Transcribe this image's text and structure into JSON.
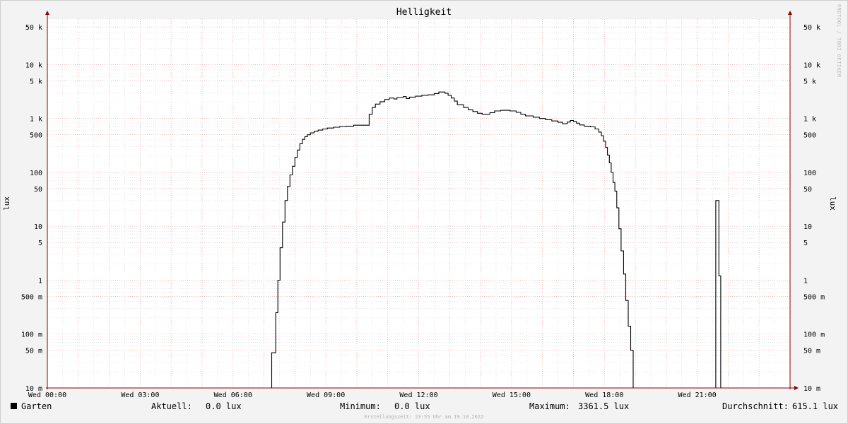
{
  "title": "Helligkeit",
  "watermark": "RRDTOOL / TOBI OETIKER",
  "footer": "Erstellungszeit: 23:55 Uhr am 19.10.2022",
  "legend": {
    "series_name": "Garten",
    "current_label": "Aktuell:",
    "current_value": "0.0 lux",
    "min_label": "Minimum:",
    "min_value": "0.0 lux",
    "max_label": "Maximum:",
    "max_value": "3361.5 lux",
    "avg_label": "Durchschnitt:",
    "avg_value": "615.1 lux"
  },
  "colors": {
    "background": "#f3f3f3",
    "plot_background": "#ffffff",
    "major_grid": "#e8a0a0",
    "minor_grid": "#d8d8d8",
    "axis": "#8b0000",
    "line": "#000000"
  },
  "chart_data": {
    "type": "line",
    "title": "Helligkeit",
    "ylabel": "lux",
    "y_scale": "log",
    "ylim": [
      0.01,
      70000
    ],
    "xlim": [
      0,
      24
    ],
    "grid": true,
    "y_ticks": [
      {
        "value": 0.01,
        "label": "10 m"
      },
      {
        "value": 0.05,
        "label": "50 m"
      },
      {
        "value": 0.1,
        "label": "100 m"
      },
      {
        "value": 0.5,
        "label": "500 m"
      },
      {
        "value": 1,
        "label": "1"
      },
      {
        "value": 5,
        "label": "5"
      },
      {
        "value": 10,
        "label": "10"
      },
      {
        "value": 50,
        "label": "50"
      },
      {
        "value": 100,
        "label": "100"
      },
      {
        "value": 500,
        "label": "500"
      },
      {
        "value": 1000,
        "label": "1 k"
      },
      {
        "value": 5000,
        "label": "5 k"
      },
      {
        "value": 10000,
        "label": "10 k"
      },
      {
        "value": 50000,
        "label": "50 k"
      }
    ],
    "x_ticks": [
      {
        "value": 0,
        "label": "Wed 00:00"
      },
      {
        "value": 3,
        "label": "Wed 03:00"
      },
      {
        "value": 6,
        "label": "Wed 06:00"
      },
      {
        "value": 9,
        "label": "Wed 09:00"
      },
      {
        "value": 12,
        "label": "Wed 12:00"
      },
      {
        "value": 15,
        "label": "Wed 15:00"
      },
      {
        "value": 18,
        "label": "Wed 18:00"
      },
      {
        "value": 21,
        "label": "Wed 21:00"
      }
    ],
    "series": [
      {
        "name": "Garten",
        "points": [
          [
            0,
            0.01
          ],
          [
            7.25,
            0.01
          ],
          [
            7.25,
            0.045
          ],
          [
            7.38,
            0.045
          ],
          [
            7.38,
            0.25
          ],
          [
            7.45,
            0.25
          ],
          [
            7.45,
            1.0
          ],
          [
            7.52,
            1.0
          ],
          [
            7.52,
            4.0
          ],
          [
            7.6,
            4.0
          ],
          [
            7.6,
            12
          ],
          [
            7.68,
            12
          ],
          [
            7.68,
            30
          ],
          [
            7.76,
            30
          ],
          [
            7.76,
            55
          ],
          [
            7.84,
            55
          ],
          [
            7.84,
            90
          ],
          [
            7.92,
            90
          ],
          [
            7.92,
            130
          ],
          [
            8.0,
            130
          ],
          [
            8.0,
            190
          ],
          [
            8.08,
            190
          ],
          [
            8.08,
            260
          ],
          [
            8.16,
            260
          ],
          [
            8.16,
            340
          ],
          [
            8.24,
            340
          ],
          [
            8.24,
            410
          ],
          [
            8.32,
            410
          ],
          [
            8.32,
            460
          ],
          [
            8.4,
            460
          ],
          [
            8.4,
            500
          ],
          [
            8.5,
            500
          ],
          [
            8.5,
            540
          ],
          [
            8.62,
            540
          ],
          [
            8.62,
            580
          ],
          [
            8.75,
            580
          ],
          [
            8.75,
            610
          ],
          [
            8.9,
            610
          ],
          [
            8.9,
            640
          ],
          [
            9.05,
            640
          ],
          [
            9.05,
            665
          ],
          [
            9.25,
            665
          ],
          [
            9.25,
            690
          ],
          [
            9.45,
            690
          ],
          [
            9.45,
            710
          ],
          [
            9.65,
            710
          ],
          [
            9.65,
            720
          ],
          [
            9.9,
            720
          ],
          [
            9.9,
            750
          ],
          [
            10.4,
            750
          ],
          [
            10.4,
            1200
          ],
          [
            10.5,
            1200
          ],
          [
            10.5,
            1600
          ],
          [
            10.6,
            1600
          ],
          [
            10.6,
            1850
          ],
          [
            10.75,
            1850
          ],
          [
            10.75,
            2050
          ],
          [
            10.9,
            2050
          ],
          [
            10.9,
            2250
          ],
          [
            11.05,
            2250
          ],
          [
            11.05,
            2400
          ],
          [
            11.2,
            2400
          ],
          [
            11.2,
            2300
          ],
          [
            11.3,
            2300
          ],
          [
            11.3,
            2450
          ],
          [
            11.5,
            2450
          ],
          [
            11.5,
            2550
          ],
          [
            11.6,
            2550
          ],
          [
            11.6,
            2350
          ],
          [
            11.7,
            2350
          ],
          [
            11.7,
            2500
          ],
          [
            11.9,
            2500
          ],
          [
            11.9,
            2600
          ],
          [
            12.1,
            2600
          ],
          [
            12.1,
            2700
          ],
          [
            12.3,
            2700
          ],
          [
            12.3,
            2750
          ],
          [
            12.5,
            2750
          ],
          [
            12.5,
            2900
          ],
          [
            12.65,
            2900
          ],
          [
            12.65,
            3100
          ],
          [
            12.85,
            3100
          ],
          [
            12.85,
            2950
          ],
          [
            12.95,
            2950
          ],
          [
            12.95,
            2700
          ],
          [
            13.05,
            2700
          ],
          [
            13.05,
            2400
          ],
          [
            13.15,
            2400
          ],
          [
            13.15,
            2100
          ],
          [
            13.25,
            2100
          ],
          [
            13.25,
            1800
          ],
          [
            13.45,
            1800
          ],
          [
            13.45,
            1600
          ],
          [
            13.6,
            1600
          ],
          [
            13.6,
            1450
          ],
          [
            13.75,
            1450
          ],
          [
            13.75,
            1350
          ],
          [
            13.9,
            1350
          ],
          [
            13.9,
            1250
          ],
          [
            14.05,
            1250
          ],
          [
            14.05,
            1200
          ],
          [
            14.3,
            1200
          ],
          [
            14.3,
            1280
          ],
          [
            14.45,
            1280
          ],
          [
            14.45,
            1380
          ],
          [
            14.65,
            1380
          ],
          [
            14.65,
            1420
          ],
          [
            14.95,
            1420
          ],
          [
            14.95,
            1380
          ],
          [
            15.15,
            1380
          ],
          [
            15.15,
            1300
          ],
          [
            15.3,
            1300
          ],
          [
            15.3,
            1200
          ],
          [
            15.45,
            1200
          ],
          [
            15.45,
            1120
          ],
          [
            15.7,
            1120
          ],
          [
            15.7,
            1060
          ],
          [
            15.9,
            1060
          ],
          [
            15.9,
            1000
          ],
          [
            16.1,
            1000
          ],
          [
            16.1,
            950
          ],
          [
            16.3,
            950
          ],
          [
            16.3,
            900
          ],
          [
            16.5,
            900
          ],
          [
            16.5,
            850
          ],
          [
            16.65,
            850
          ],
          [
            16.65,
            800
          ],
          [
            16.8,
            800
          ],
          [
            16.8,
            860
          ],
          [
            16.9,
            860
          ],
          [
            16.9,
            920
          ],
          [
            17.0,
            920
          ],
          [
            17.0,
            880
          ],
          [
            17.1,
            880
          ],
          [
            17.1,
            820
          ],
          [
            17.2,
            820
          ],
          [
            17.2,
            760
          ],
          [
            17.35,
            760
          ],
          [
            17.35,
            720
          ],
          [
            17.55,
            720
          ],
          [
            17.55,
            700
          ],
          [
            17.7,
            700
          ],
          [
            17.7,
            640
          ],
          [
            17.82,
            640
          ],
          [
            17.82,
            560
          ],
          [
            17.9,
            560
          ],
          [
            17.9,
            480
          ],
          [
            17.97,
            480
          ],
          [
            17.97,
            380
          ],
          [
            18.04,
            380
          ],
          [
            18.04,
            290
          ],
          [
            18.1,
            290
          ],
          [
            18.1,
            210
          ],
          [
            18.16,
            210
          ],
          [
            18.16,
            150
          ],
          [
            18.22,
            150
          ],
          [
            18.22,
            100
          ],
          [
            18.28,
            100
          ],
          [
            18.28,
            65
          ],
          [
            18.34,
            65
          ],
          [
            18.34,
            45
          ],
          [
            18.4,
            45
          ],
          [
            18.4,
            22
          ],
          [
            18.47,
            22
          ],
          [
            18.47,
            9
          ],
          [
            18.54,
            9
          ],
          [
            18.54,
            3.5
          ],
          [
            18.62,
            3.5
          ],
          [
            18.62,
            1.3
          ],
          [
            18.69,
            1.3
          ],
          [
            18.69,
            0.42
          ],
          [
            18.77,
            0.42
          ],
          [
            18.77,
            0.14
          ],
          [
            18.85,
            0.14
          ],
          [
            18.85,
            0.05
          ],
          [
            18.93,
            0.05
          ],
          [
            18.93,
            0.01
          ],
          [
            21.6,
            0.01
          ],
          [
            21.6,
            30
          ],
          [
            21.7,
            30
          ],
          [
            21.7,
            1.2
          ],
          [
            21.76,
            1.2
          ],
          [
            21.76,
            0.01
          ],
          [
            24,
            0.01
          ]
        ]
      }
    ]
  }
}
